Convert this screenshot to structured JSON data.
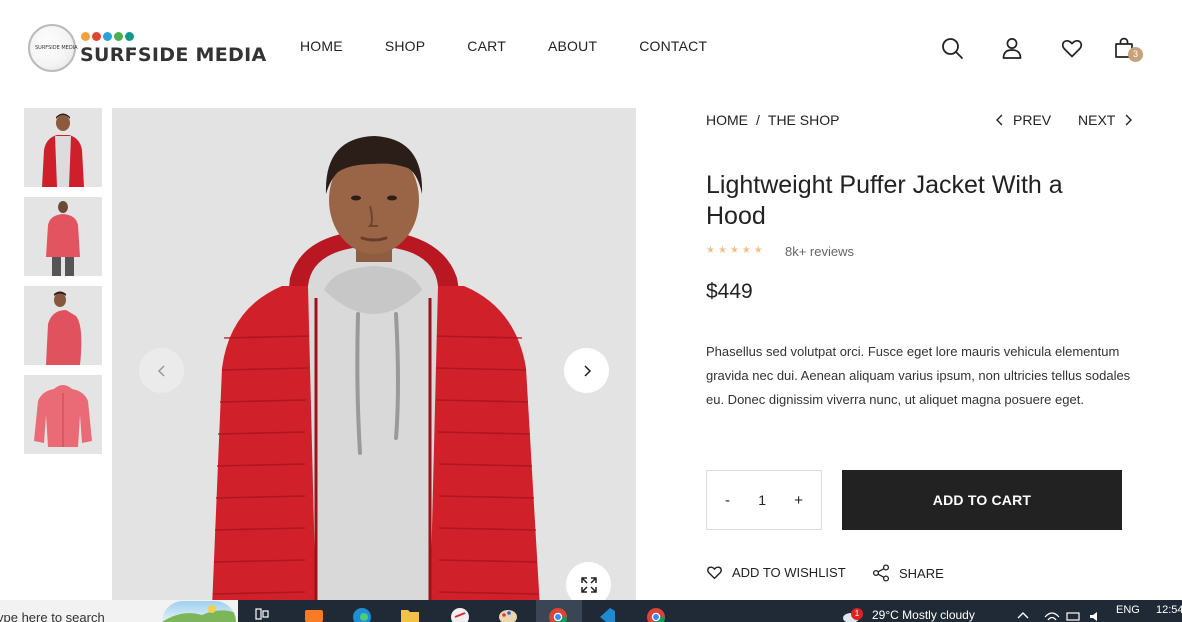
{
  "brand": {
    "name": "SURFSIDE MEDIA",
    "circle_text": "SURFSIDE MEDIA",
    "dot_colors": [
      "#f0a13c",
      "#e2452f",
      "#2aa3d8",
      "#4caf50",
      "#139a8c"
    ]
  },
  "nav": {
    "items": [
      "HOME",
      "SHOP",
      "CART",
      "ABOUT",
      "CONTACT"
    ]
  },
  "header_icons": {
    "search": "search-icon",
    "account": "user-icon",
    "wishlist": "heart-icon",
    "cart": "bag-icon",
    "cart_count": "3"
  },
  "gallery": {
    "thumbnails": [
      "front-view",
      "back-view",
      "side-view",
      "product-only"
    ],
    "main_alt": "model wearing red puffer jacket with grey hoodie"
  },
  "breadcrumb": {
    "home": "HOME",
    "separator": "/",
    "current": "THE SHOP"
  },
  "pager": {
    "prev": "PREV",
    "next": "NEXT"
  },
  "product": {
    "title": "Lightweight Puffer Jacket With a Hood",
    "rating": 5,
    "reviews": "8k+ reviews",
    "price": "$449",
    "description": "Phasellus sed volutpat orci. Fusce eget lore mauris vehicula elementum gravida nec dui. Aenean aliquam varius ipsum, non ultricies tellus sodales eu. Donec dignissim viverra nunc, ut aliquet magna posuere eget."
  },
  "purchase": {
    "minus": "-",
    "quantity": "1",
    "plus": "+",
    "add_to_cart": "ADD TO CART"
  },
  "actions": {
    "wishlist": "ADD TO WISHLIST",
    "share": "SHARE"
  },
  "colors": {
    "accent_dark": "#222222",
    "badge": "#c7a17a",
    "star": "#f3c28a",
    "jacket_red": "#d0202a",
    "taskbar": "#1f2a36"
  },
  "taskbar": {
    "search_placeholder": "ype here to search",
    "weather_badge": "1",
    "weather": "29°C  Mostly cloudy",
    "language": "ENG",
    "time": "12:54"
  }
}
